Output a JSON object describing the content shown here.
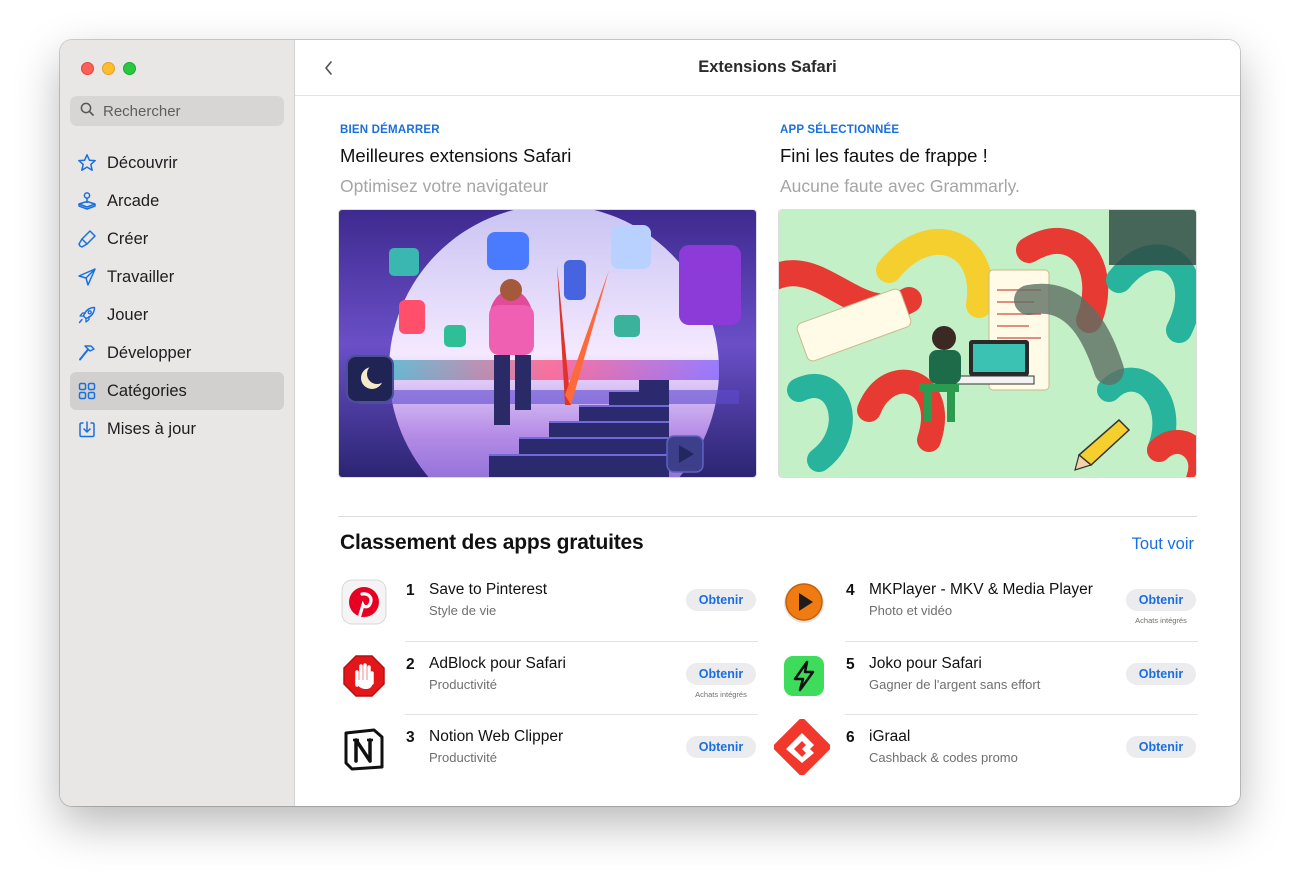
{
  "window": {
    "title": "Extensions Safari"
  },
  "search": {
    "placeholder": "Rechercher"
  },
  "sidebar": {
    "items": [
      {
        "label": "Découvrir",
        "icon": "star-icon"
      },
      {
        "label": "Arcade",
        "icon": "joystick-icon"
      },
      {
        "label": "Créer",
        "icon": "brush-icon"
      },
      {
        "label": "Travailler",
        "icon": "paper-plane-icon"
      },
      {
        "label": "Jouer",
        "icon": "rocket-icon"
      },
      {
        "label": "Développer",
        "icon": "hammer-icon"
      },
      {
        "label": "Catégories",
        "icon": "grid-icon",
        "active": true
      },
      {
        "label": "Mises à jour",
        "icon": "download-icon"
      }
    ]
  },
  "features": [
    {
      "eyebrow": "BIEN DÉMARRER",
      "title": "Meilleures extensions Safari",
      "subtitle": "Optimisez votre navigateur"
    },
    {
      "eyebrow": "APP SÉLECTIONNÉE",
      "title": "Fini les fautes de frappe !",
      "subtitle": "Aucune faute avec Grammarly."
    }
  ],
  "ranking": {
    "title": "Classement des apps gratuites",
    "see_all": "Tout voir",
    "get_label": "Obtenir",
    "in_app_label": "Achats intégrés",
    "apps": [
      {
        "rank": "1",
        "name": "Save to Pinterest",
        "category": "Style de vie",
        "icon": "pinterest-icon"
      },
      {
        "rank": "2",
        "name": "AdBlock pour Safari",
        "category": "Productivité",
        "icon": "adblock-hand-icon",
        "in_app": true
      },
      {
        "rank": "3",
        "name": "Notion Web Clipper",
        "category": "Productivité",
        "icon": "notion-icon"
      },
      {
        "rank": "4",
        "name": "MKPlayer - MKV & Media Player",
        "category": "Photo et vidéo",
        "icon": "play-icon",
        "in_app": true
      },
      {
        "rank": "5",
        "name": "Joko pour Safari",
        "category": "Gagner de l'argent sans effort",
        "icon": "lightning-icon"
      },
      {
        "rank": "6",
        "name": "iGraal",
        "category": "Cashback & codes promo",
        "icon": "igraal-icon"
      }
    ]
  },
  "colors": {
    "accent": "#1a6fe0",
    "sidebar_bg": "#e9e7e6",
    "active_item": "#d1d0cf"
  }
}
